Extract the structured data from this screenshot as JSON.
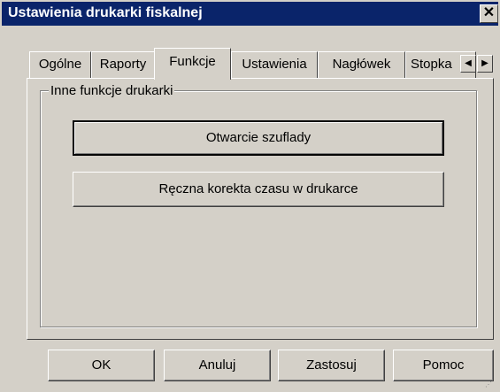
{
  "window": {
    "title": "Ustawienia drukarki fiskalnej",
    "close_symbol": "✕"
  },
  "tabs": [
    {
      "label": "Ogólne",
      "active": false
    },
    {
      "label": "Raporty",
      "active": false
    },
    {
      "label": "Funkcje",
      "active": true
    },
    {
      "label": "Ustawienia",
      "active": false
    },
    {
      "label": "Nagłówek",
      "active": false
    },
    {
      "label": "Stopka",
      "active": false
    }
  ],
  "tab_scroll": {
    "left_symbol": "◀",
    "right_symbol": "▶"
  },
  "group": {
    "label": "Inne funkcje drukarki"
  },
  "functions": {
    "open_drawer": "Otwarcie szuflady",
    "manual_time_correction": "Ręczna korekta czasu w drukarce"
  },
  "dialog_buttons": {
    "ok": "OK",
    "cancel": "Anuluj",
    "apply": "Zastosuj",
    "help": "Pomoc"
  },
  "colors": {
    "titlebar": "#0a246a",
    "face": "#d4d0c8"
  }
}
